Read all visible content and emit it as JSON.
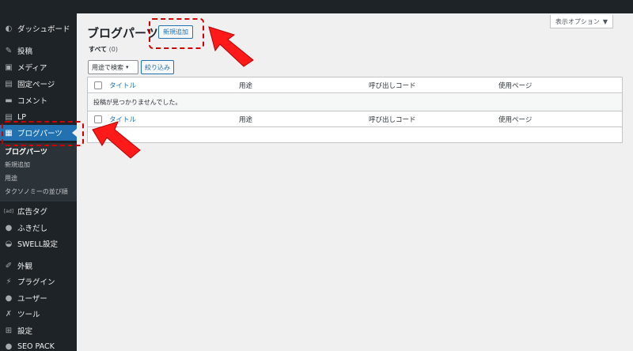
{
  "sidebar": {
    "items": [
      {
        "label": "ダッシュボード",
        "icon": "dashboard-icon",
        "glyph": "◐"
      },
      {
        "label": "投稿",
        "icon": "pin-icon",
        "glyph": "✎"
      },
      {
        "label": "メディア",
        "icon": "media-icon",
        "glyph": "▣"
      },
      {
        "label": "固定ページ",
        "icon": "page-icon",
        "glyph": "▤"
      },
      {
        "label": "コメント",
        "icon": "comment-icon",
        "glyph": "▬"
      },
      {
        "label": "LP",
        "icon": "lp-icon",
        "glyph": "▤"
      },
      {
        "label": "ブログパーツ",
        "icon": "blog-parts-icon",
        "glyph": "▦"
      },
      {
        "label": "広告タグ",
        "icon": "ad-icon",
        "glyph": "[ad]"
      },
      {
        "label": "ふきだし",
        "icon": "balloon-icon",
        "glyph": "●"
      },
      {
        "label": "SWELL設定",
        "icon": "swell-icon",
        "glyph": "◒"
      },
      {
        "label": "外観",
        "icon": "appearance-icon",
        "glyph": "✐"
      },
      {
        "label": "プラグイン",
        "icon": "plugin-icon",
        "glyph": "⚡"
      },
      {
        "label": "ユーザー",
        "icon": "user-icon",
        "glyph": "●"
      },
      {
        "label": "ツール",
        "icon": "tool-icon",
        "glyph": "✗"
      },
      {
        "label": "設定",
        "icon": "settings-icon",
        "glyph": "⊞"
      },
      {
        "label": "SEO PACK",
        "icon": "seo-icon",
        "glyph": "●"
      }
    ],
    "submenu": [
      "ブログパーツ",
      "新規追加",
      "用途",
      "タクソノミーの並び順"
    ]
  },
  "header": {
    "title": "ブログパーツ",
    "add_new": "新規追加",
    "screen_options": "表示オプション",
    "screen_options_caret": "▼"
  },
  "views": {
    "all_label": "すべて",
    "all_count": "(0)"
  },
  "filter": {
    "select_value": "用途で検索",
    "select_caret": "▾",
    "button": "絞り込み"
  },
  "table": {
    "columns": [
      "タイトル",
      "用途",
      "呼び出しコード",
      "使用ページ"
    ],
    "empty_message": "投稿が見つかりませんでした。"
  },
  "accent_colors": {
    "highlight": "#d10000",
    "arrow": "#ff1a1a",
    "wp_blue": "#2271b1"
  }
}
